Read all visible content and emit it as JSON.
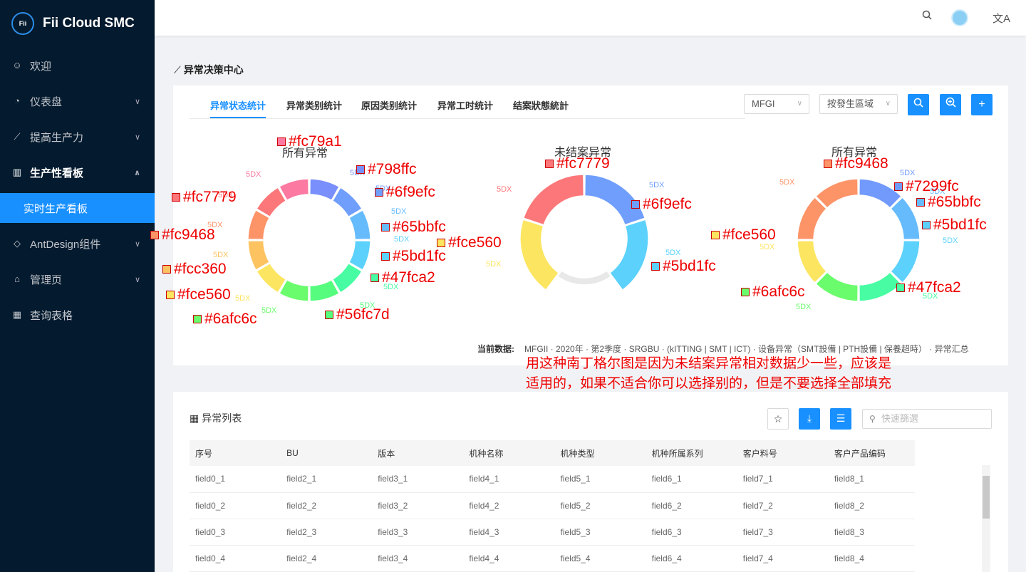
{
  "app": {
    "logo_mark": "Fii",
    "title": "Fii Cloud SMC"
  },
  "sidebar": {
    "items": [
      {
        "label": "欢迎",
        "icon": "smile-icon"
      },
      {
        "label": "仪表盘",
        "icon": "dashboard-icon"
      },
      {
        "label": "提高生产力",
        "icon": "line-chart-icon"
      },
      {
        "label": "生产性看板",
        "icon": "bar-chart-icon"
      },
      {
        "label": "实时生产看板"
      },
      {
        "label": "AntDesign组件",
        "icon": "diamond-icon"
      },
      {
        "label": "管理页",
        "icon": "home-icon"
      },
      {
        "label": "查询表格",
        "icon": "table-icon"
      }
    ]
  },
  "header": {
    "search_icon": "search-icon",
    "avatar": "avatar",
    "lang_icon": "translate-icon"
  },
  "page": {
    "title": "异常决策中心"
  },
  "tabs": [
    "异常状态统计",
    "异常类别统计",
    "原因类别统计",
    "异常工时统计",
    "结案狀態統計"
  ],
  "filters": {
    "factory": "MFGI",
    "region": "按發生區域"
  },
  "chart_data": [
    {
      "type": "pie",
      "title": "所有异常",
      "values": [
        1,
        1,
        1,
        1,
        1,
        1,
        1,
        1,
        1,
        1,
        1,
        1
      ],
      "slice_labels": [
        "5DX",
        "5DX",
        "5DX",
        "5DX",
        "5DX",
        "5DX",
        "5DX",
        "5DX",
        "5DX",
        "5DX",
        "5DX",
        "5DX"
      ],
      "colors": [
        "#798ffc",
        "#6f9efc",
        "#65bbfc",
        "#5bd1fc",
        "#47fca2",
        "#56fc7d",
        "#6afc6c",
        "#fce560",
        "#fcc360",
        "#fc9468",
        "#fc7779",
        "#fc79a1"
      ]
    },
    {
      "type": "pie",
      "title": "未结案异常",
      "values": [
        1,
        1,
        1,
        1,
        1
      ],
      "slice_labels": [
        "5DX",
        "5DX",
        "5DX",
        "5DX"
      ],
      "colors": [
        "#6f9efc",
        "#5bd1fc",
        "#e8e8e8",
        "#fce560",
        "#fc7779"
      ]
    },
    {
      "type": "pie",
      "title": "所有异常",
      "values": [
        1,
        1,
        1,
        1,
        1,
        1,
        1,
        1
      ],
      "slice_labels": [
        "5DX",
        "5DX",
        "5DX",
        "5DX",
        "5DX",
        "5DX",
        "5DX",
        "5DX"
      ],
      "colors": [
        "#7299fc",
        "#65bbfc",
        "#5bd1fc",
        "#47fca2",
        "#6afc6c",
        "#fce560",
        "#fc9468",
        "#fc9468"
      ]
    }
  ],
  "annotations": [
    {
      "text": "#fc79a1",
      "color": "#fc79a1"
    },
    {
      "text": "#798ffc",
      "color": "#798ffc"
    },
    {
      "text": "#6f9efc",
      "color": "#6f9efc"
    },
    {
      "text": "#fc7779",
      "color": "#fc7779"
    },
    {
      "text": "#65bbfc",
      "color": "#65bbfc"
    },
    {
      "text": "#fc9468",
      "color": "#fc9468"
    },
    {
      "text": "#5bd1fc",
      "color": "#5bd1fc"
    },
    {
      "text": "#fcc360",
      "color": "#fcc360"
    },
    {
      "text": "#47fca2",
      "color": "#47fca2"
    },
    {
      "text": "#fce560",
      "color": "#fce560"
    },
    {
      "text": "#56fc7d",
      "color": "#56fc7d"
    },
    {
      "text": "#6afc6c",
      "color": "#6afc6c"
    },
    {
      "text": "#fc7779",
      "color": "#fc7779"
    },
    {
      "text": "#6f9efc",
      "color": "#6f9efc"
    },
    {
      "text": "#fce560",
      "color": "#fce560"
    },
    {
      "text": "#5bd1fc",
      "color": "#5bd1fc"
    },
    {
      "text": "#fc9468",
      "color": "#fc9468"
    },
    {
      "text": "#7299fc",
      "color": "#7299fc"
    },
    {
      "text": "#65bbfc",
      "color": "#65bbfc"
    },
    {
      "text": "#fce560",
      "color": "#fce560"
    },
    {
      "text": "#5bd1fc",
      "color": "#5bd1fc"
    },
    {
      "text": "#6afc6c",
      "color": "#6afc6c"
    },
    {
      "text": "#47fca2",
      "color": "#47fca2"
    }
  ],
  "current": {
    "label": "当前数据:",
    "value": "MFGII · 2020年 · 第2季度 · SRGBU · (kITTING | SMT | ICT) · 设备异常（SMT設備 | PTH設備 | 保養超時） · 异常汇总"
  },
  "note": "用这种南丁格尔图是因为未结案异常相对数据少一些，应该是适用的，如果不适合你可以选择别的，但是不要选择全部填充的~",
  "list": {
    "title": "异常列表",
    "search_placeholder": "快速篩選",
    "columns": [
      "序号",
      "BU",
      "版本",
      "机种名称",
      "机种类型",
      "机种所属系列",
      "客户料号",
      "客户产品编码"
    ],
    "rows": [
      [
        "field0_1",
        "field2_1",
        "field3_1",
        "field4_1",
        "field5_1",
        "field6_1",
        "field7_1",
        "field8_1"
      ],
      [
        "field0_2",
        "field2_2",
        "field3_2",
        "field4_2",
        "field5_2",
        "field6_2",
        "field7_2",
        "field8_2"
      ],
      [
        "field0_3",
        "field2_3",
        "field3_3",
        "field4_3",
        "field5_3",
        "field6_3",
        "field7_3",
        "field8_3"
      ],
      [
        "field0_4",
        "field2_4",
        "field3_4",
        "field4_4",
        "field5_4",
        "field6_4",
        "field7_4",
        "field8_4"
      ]
    ]
  }
}
